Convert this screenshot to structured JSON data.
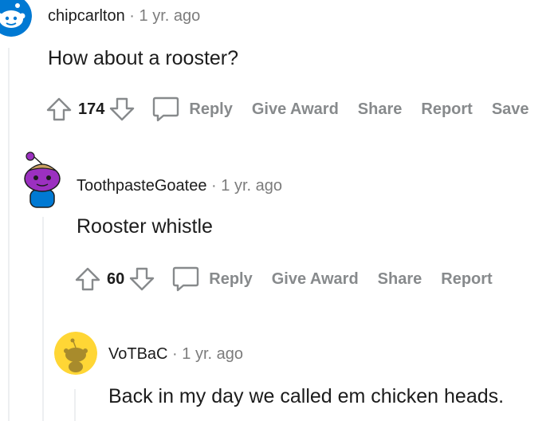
{
  "comments": [
    {
      "username": "chipcarlton",
      "separator": "·",
      "time": "1 yr. ago",
      "body": "How about a rooster?",
      "votes": "174",
      "actions": {
        "reply": "Reply",
        "give_award": "Give Award",
        "share": "Share",
        "report": "Report",
        "save": "Save"
      }
    },
    {
      "username": "ToothpasteGoatee",
      "separator": "·",
      "time": "1 yr. ago",
      "body": "Rooster whistle",
      "votes": "60",
      "actions": {
        "reply": "Reply",
        "give_award": "Give Award",
        "share": "Share",
        "report": "Report"
      }
    },
    {
      "username": "VoTBaC",
      "separator": "·",
      "time": "1 yr. ago",
      "body": "Back in my day we called em chicken heads."
    }
  ],
  "colors": {
    "text": "#1c1c1c",
    "meta": "#7c7c7c",
    "action": "#878a8c",
    "thread_line": "#edeff1",
    "avatar_blue": "#0079d3",
    "avatar_purple": "#9b30c0",
    "avatar_yellow": "#ffd635"
  }
}
